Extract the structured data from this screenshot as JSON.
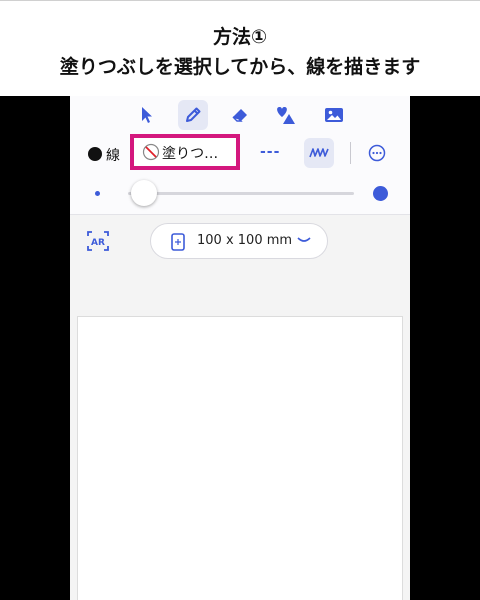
{
  "caption": {
    "title": "方法①",
    "subtitle": "塗りつぶしを選択してから、線を描きます"
  },
  "toolbar": {
    "tools": [
      {
        "icon": "pointer-icon",
        "active": false
      },
      {
        "icon": "pen-icon",
        "active": true
      },
      {
        "icon": "eraser-icon",
        "active": false
      },
      {
        "icon": "shapes-icon",
        "active": false
      },
      {
        "icon": "image-icon",
        "active": false
      }
    ],
    "stroke_color_label": "線",
    "stroke_color": "#111111",
    "fill_label": "塗りつ…",
    "fill_icon": "no-fill-icon",
    "dash_label": "---",
    "smoothing_icon": "smooth-stroke-icon",
    "more_icon": "more-options-icon",
    "accent_color": "#3d5bd9",
    "highlight_color": "#d4187e"
  },
  "brush_size_slider": {
    "value_fraction": 0.07
  },
  "canvas_bar": {
    "ar_label": "AR",
    "size_label": "100 x 100 mm"
  }
}
